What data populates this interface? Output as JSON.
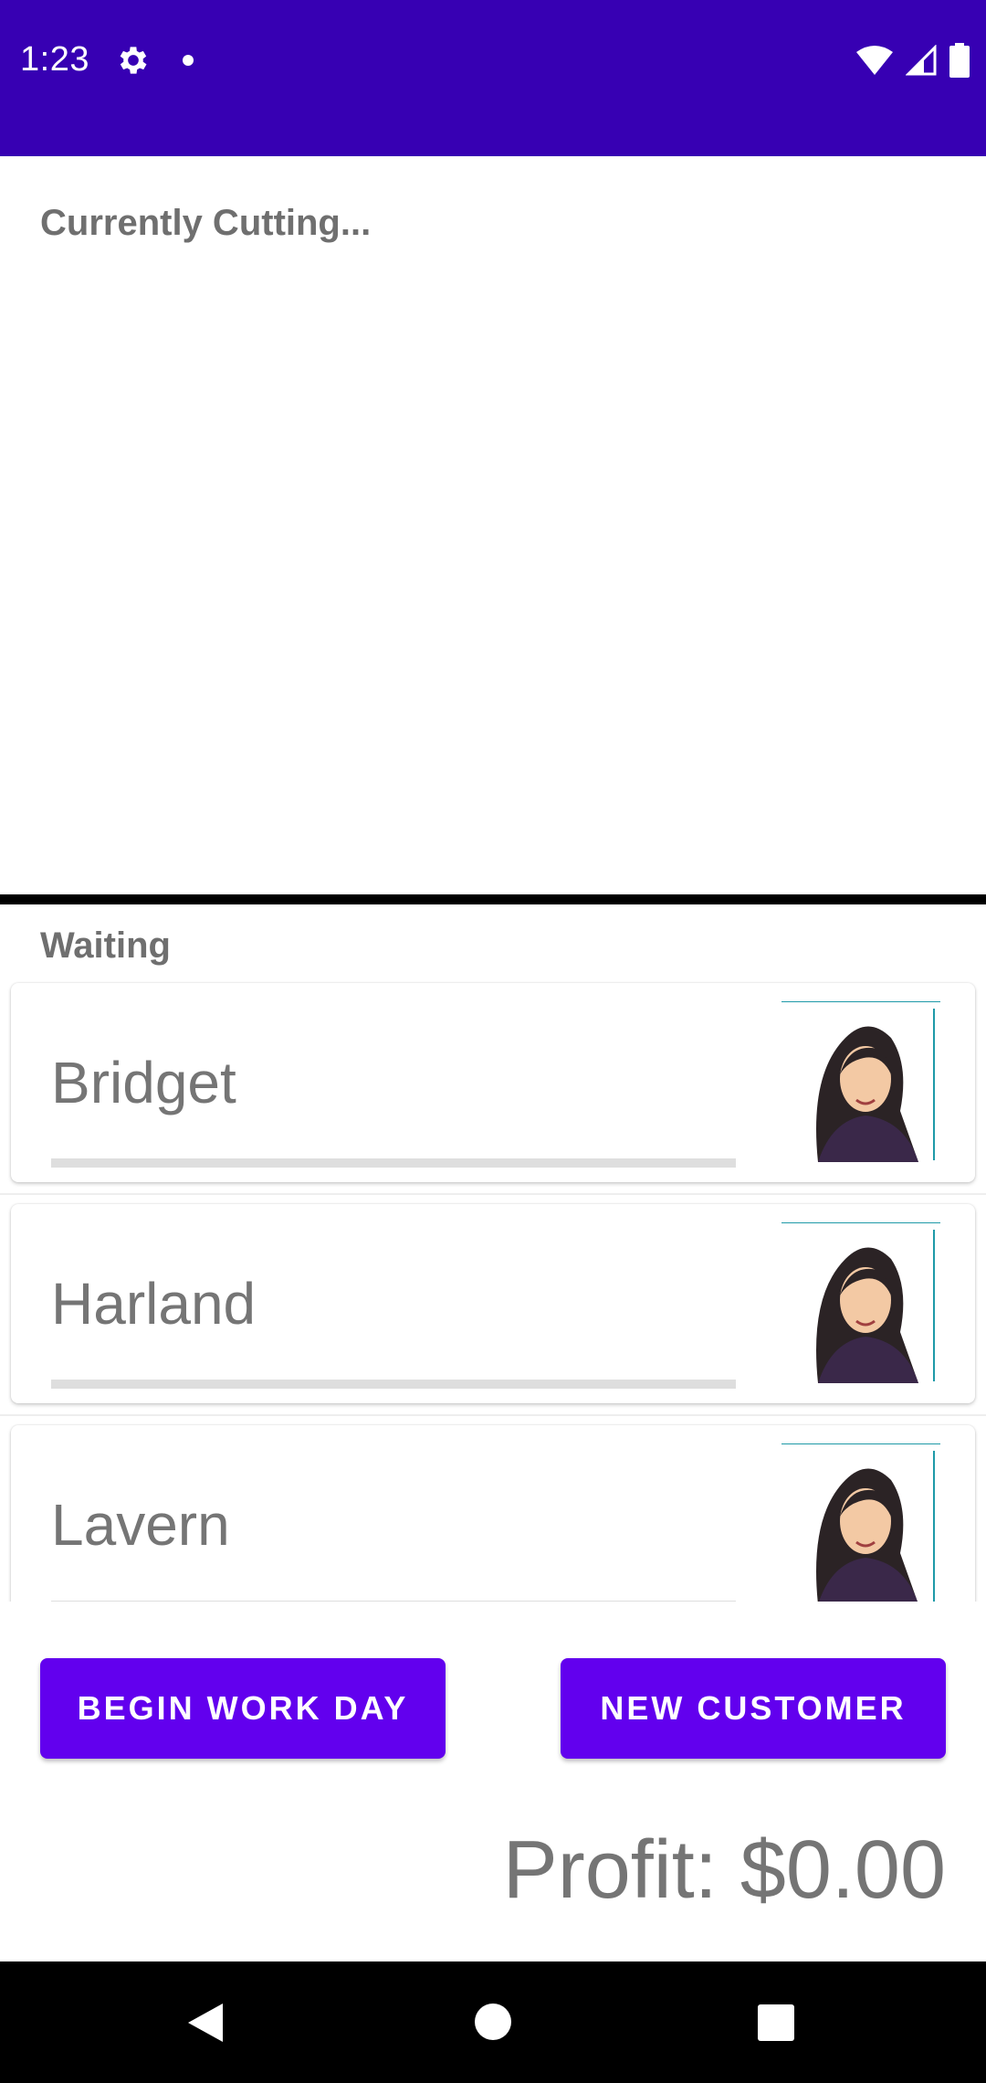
{
  "status_bar": {
    "time": "1:23",
    "icons": [
      "gear-icon",
      "notification-dot-icon",
      "wifi-icon",
      "signal-icon",
      "battery-icon"
    ],
    "background": "#3700b3"
  },
  "current": {
    "title": "Currently Cutting..."
  },
  "waiting": {
    "title": "Waiting",
    "customers": [
      {
        "name": "Bridget",
        "avatar": "woman-avatar-icon"
      },
      {
        "name": "Harland",
        "avatar": "woman-avatar-icon"
      },
      {
        "name": "Lavern",
        "avatar": "woman-avatar-icon"
      }
    ]
  },
  "actions": {
    "begin_label": "BEGIN WORK DAY",
    "new_customer_label": "NEW CUSTOMER",
    "accent": "#6200ee"
  },
  "profit": {
    "text": "Profit: $0.00"
  },
  "nav": {
    "icons": [
      "back-icon",
      "home-icon",
      "recents-icon"
    ]
  }
}
